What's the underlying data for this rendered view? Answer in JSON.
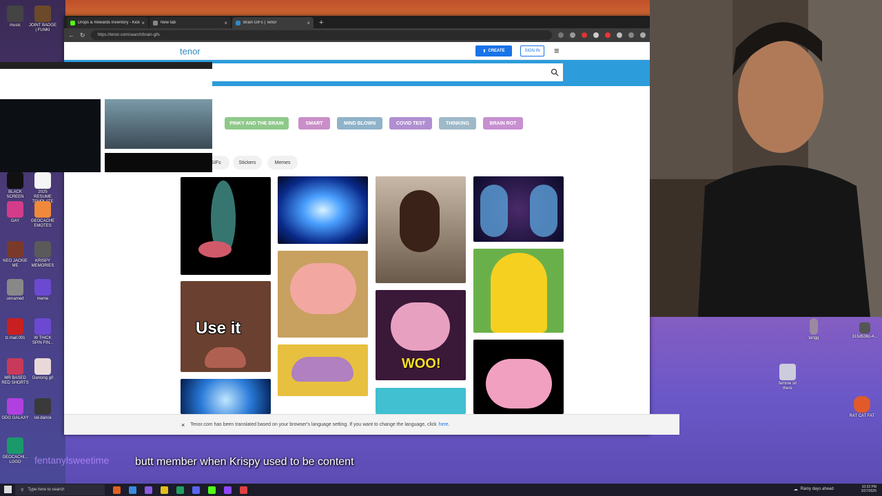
{
  "browser": {
    "tabs": [
      {
        "label": "Drops & Rewards Inventory - Kick",
        "favicon_color": "#53fc18",
        "active": false
      },
      {
        "label": "New tab",
        "favicon_color": "#888888",
        "active": false
      },
      {
        "label": "Brain GIFs | Tenor",
        "favicon_color": "#2f8ac5",
        "active": true
      }
    ],
    "new_tab_symbol": "+",
    "url": "https://tenor.com/search/brain-gifs"
  },
  "tenor": {
    "logo": "tenor",
    "create_label": "CREATE",
    "signin_label": "SIGN IN",
    "search_value": "",
    "related_chips": [
      {
        "label": "PINKY AND THE BRAIN",
        "color": "#8fc98a"
      },
      {
        "label": "SMART",
        "color": "#c98fc8"
      },
      {
        "label": "MIND BLOWN",
        "color": "#8fb3c9"
      },
      {
        "label": "COVID TEST",
        "color": "#b08fd1"
      },
      {
        "label": "THINKING",
        "color": "#9fb9c9"
      },
      {
        "label": "BRAIN ROT",
        "color": "#c88fd1"
      }
    ],
    "filter_tabs": [
      "GIFs",
      "Stickers",
      "Memes"
    ],
    "gif_texts": {
      "use_it": "Use it",
      "woo": "WOO!"
    },
    "translate_notice": "Tenor.com has been translated based on your browser's language setting. If you want to change the language, click",
    "translate_link": "here",
    "translate_suffix": "."
  },
  "desktop_icons": [
    {
      "label": "music",
      "color": "#444444"
    },
    {
      "label": "JOINT BADGE | FUNKI",
      "color": "#6b4a2a"
    },
    {
      "label": "BLACK SCREEN",
      "color": "#111111"
    },
    {
      "label": "2025 RESUME TEMPLATE",
      "color": "#f5f5f5"
    },
    {
      "label": "GAY",
      "color": "#d23c8a"
    },
    {
      "label": "GEOCACHE EMOTES",
      "color": "#f08a3a"
    },
    {
      "label": "NEO JACKIE ME",
      "color": "#7a3a2a"
    },
    {
      "label": "KRISPY MEMORIES",
      "color": "#5a5a5a"
    },
    {
      "label": "unnamed",
      "color": "#888888"
    },
    {
      "label": "meme",
      "color": "#6b4ad1"
    },
    {
      "label": "tz.mail.001",
      "color": "#c82020"
    },
    {
      "label": "W THICK SPIN FIN...",
      "color": "#6b4ad1"
    },
    {
      "label": "MR BASED RED SHORTS",
      "color": "#c83a5a"
    },
    {
      "label": "Dancing gif",
      "color": "#e8d8d8"
    },
    {
      "label": "GDG GALAXY",
      "color": "#b040e0"
    },
    {
      "label": "rat-dance",
      "color": "#3a3a3a"
    },
    {
      "label": "GEOCACHI... LOGO",
      "color": "#1a9a6a"
    }
  ],
  "right_desktop_icons": [
    {
      "label": "tangg"
    },
    {
      "label": "315d536c-4..."
    },
    {
      "label": "femme sit there"
    },
    {
      "label": "RAT CAT FAT"
    }
  ],
  "taskbar": {
    "search_placeholder": "Type here to search",
    "weather": "Rainy days ahead",
    "time": "10:33 PM",
    "date": "3/27/2025"
  },
  "caption": {
    "text": "butt member when Krispy used to be content",
    "username": "fentanylsweetime"
  }
}
